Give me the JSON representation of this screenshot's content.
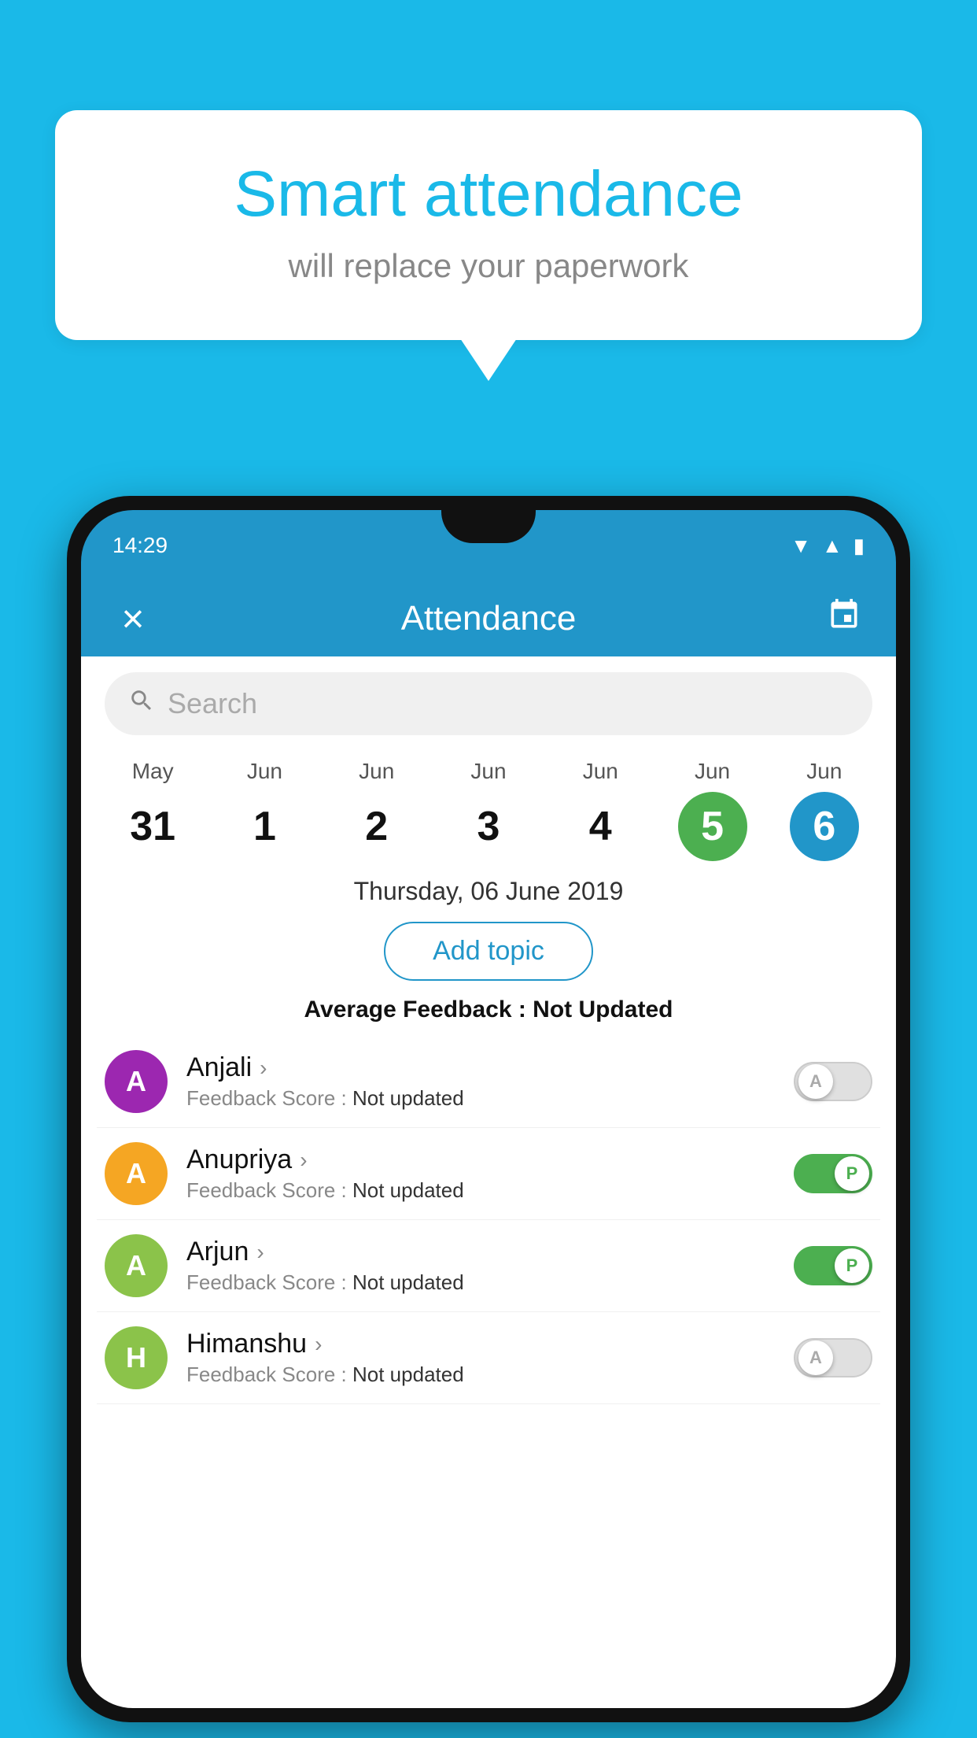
{
  "background": {
    "color": "#1ab9e8"
  },
  "speech_bubble": {
    "title": "Smart attendance",
    "subtitle": "will replace your paperwork"
  },
  "phone": {
    "status_bar": {
      "time": "14:29"
    },
    "app_bar": {
      "title": "Attendance",
      "close_label": "×",
      "calendar_label": "📅"
    },
    "search": {
      "placeholder": "Search"
    },
    "calendar": {
      "days": [
        {
          "month": "May",
          "date": "31",
          "state": "normal"
        },
        {
          "month": "Jun",
          "date": "1",
          "state": "normal"
        },
        {
          "month": "Jun",
          "date": "2",
          "state": "normal"
        },
        {
          "month": "Jun",
          "date": "3",
          "state": "normal"
        },
        {
          "month": "Jun",
          "date": "4",
          "state": "normal"
        },
        {
          "month": "Jun",
          "date": "5",
          "state": "today"
        },
        {
          "month": "Jun",
          "date": "6",
          "state": "selected"
        }
      ]
    },
    "selected_date_label": "Thursday, 06 June 2019",
    "add_topic_label": "Add topic",
    "avg_feedback_label": "Average Feedback : ",
    "avg_feedback_value": "Not Updated",
    "students": [
      {
        "name": "Anjali",
        "avatar_letter": "A",
        "avatar_color": "#9c27b0",
        "feedback_label": "Feedback Score : ",
        "feedback_value": "Not updated",
        "toggle": "off",
        "toggle_letter": "A"
      },
      {
        "name": "Anupriya",
        "avatar_letter": "A",
        "avatar_color": "#f5a623",
        "feedback_label": "Feedback Score : ",
        "feedback_value": "Not updated",
        "toggle": "on",
        "toggle_letter": "P"
      },
      {
        "name": "Arjun",
        "avatar_letter": "A",
        "avatar_color": "#8bc34a",
        "feedback_label": "Feedback Score : ",
        "feedback_value": "Not updated",
        "toggle": "on",
        "toggle_letter": "P"
      },
      {
        "name": "Himanshu",
        "avatar_letter": "H",
        "avatar_color": "#8bc34a",
        "feedback_label": "Feedback Score : ",
        "feedback_value": "Not updated",
        "toggle": "off",
        "toggle_letter": "A"
      }
    ]
  }
}
